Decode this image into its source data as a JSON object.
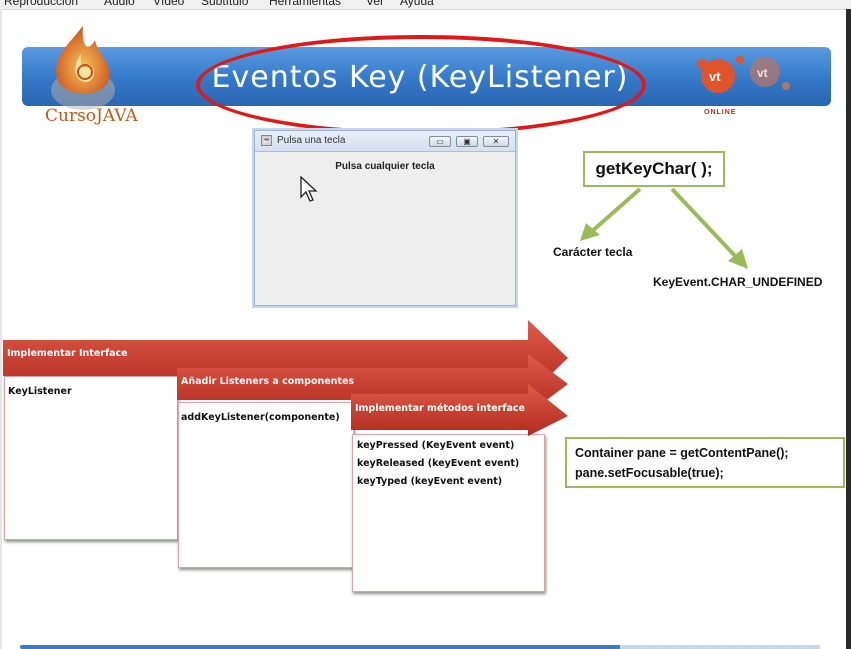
{
  "menu": [
    "Reproducción",
    "Audio",
    "Vídeo",
    "Subtítulo",
    "Herramientas",
    "Ver",
    "Ayuda"
  ],
  "banner": {
    "title": "Eventos Key (KeyListener)",
    "logo_left_text": "CursoJAVA",
    "logo_right_text": "ONLINE"
  },
  "java_window": {
    "title": "Pulsa una tecla",
    "body_text": "Pulsa cualquier tecla",
    "buttons": [
      "minimize",
      "maximize",
      "close"
    ]
  },
  "diagram": {
    "method": "getKeyChar( );",
    "branch_left": "Carácter tecla",
    "branch_right": "KeyEvent.CHAR_UNDEFINED"
  },
  "steps": [
    {
      "heading": "Implementar Interface",
      "items": [
        "KeyListener"
      ]
    },
    {
      "heading": "Añadir Listeners a componentes",
      "items": [
        "addKeyListener(componente)"
      ]
    },
    {
      "heading": "Implementar métodos interface",
      "items": [
        "keyPressed (KeyEvent event)",
        "keyReleased (keyEvent event)",
        "keyTyped (keyEvent event)"
      ]
    }
  ],
  "code": {
    "line1": "Container pane = getContentPane();",
    "line2": "pane.setFocusable(true);"
  },
  "colors": {
    "banner_blue": "#3478c8",
    "ellipse_red": "#e01818",
    "arrow_red": "#c0392b",
    "box_green": "#9bbb59"
  }
}
